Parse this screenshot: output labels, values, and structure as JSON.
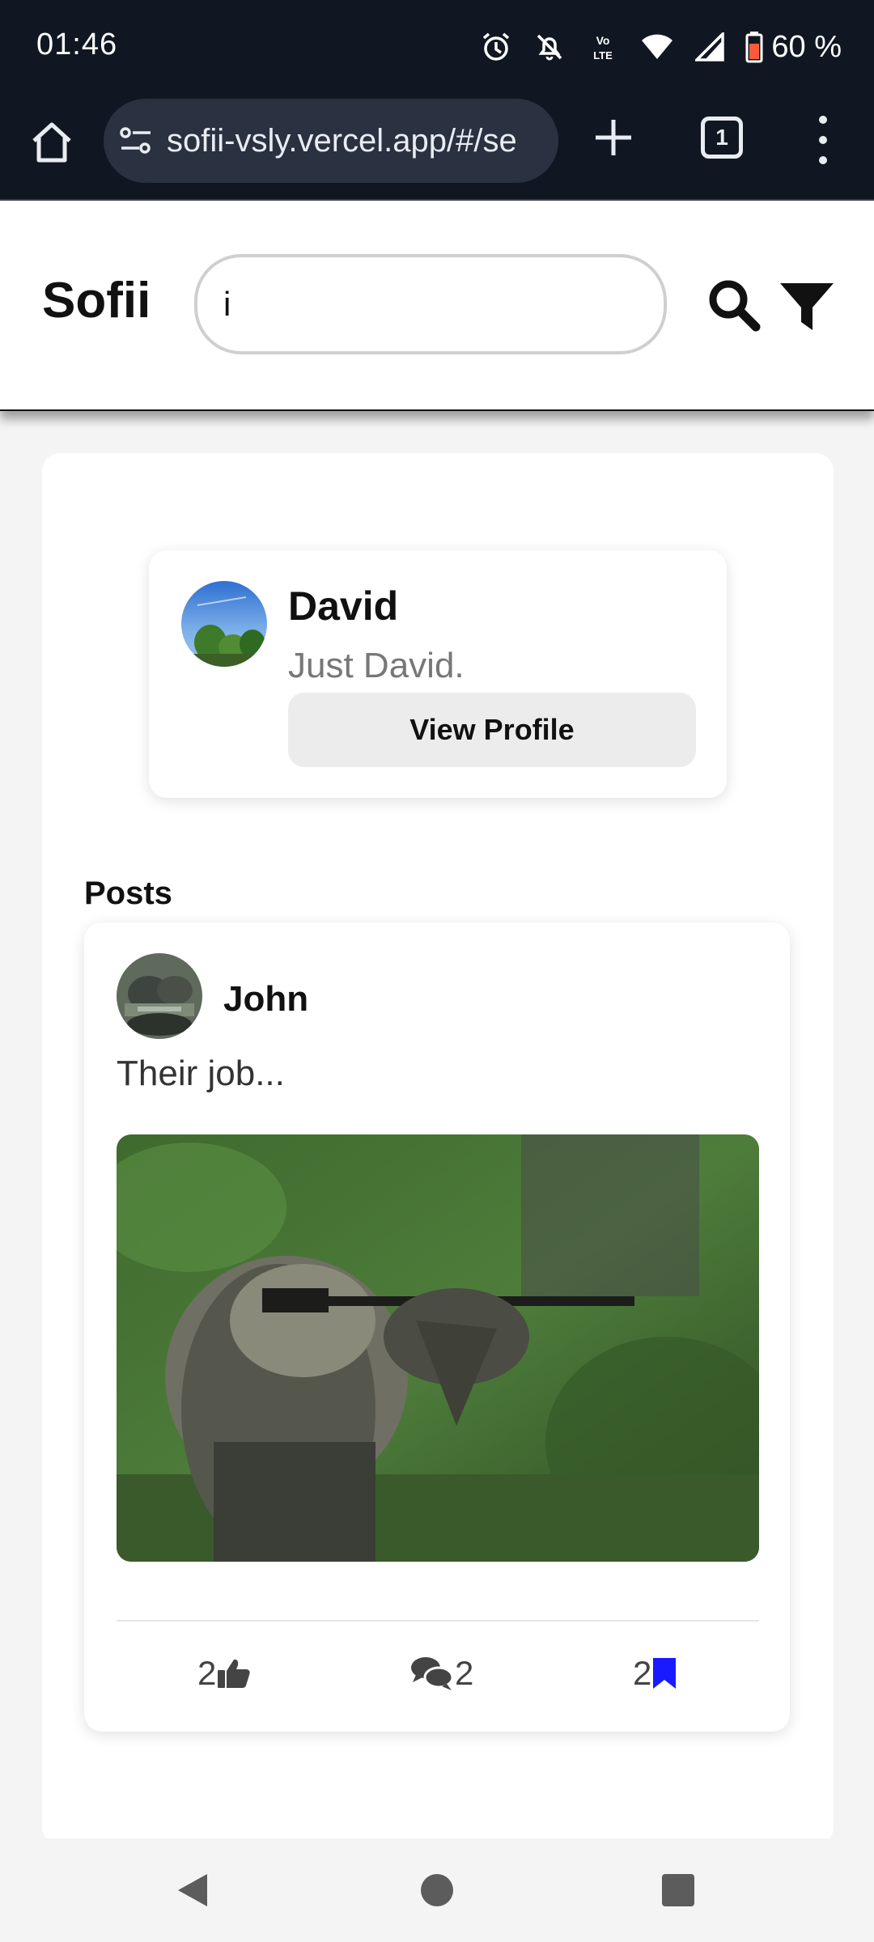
{
  "status_bar": {
    "time": "01:46",
    "battery": "60 %",
    "icons": [
      "alarm-icon",
      "silent-icon",
      "volte-icon",
      "wifi-icon",
      "signal-icon",
      "battery-icon"
    ]
  },
  "browser": {
    "url": "sofii-vsly.vercel.app/#/se",
    "tab_count": "1",
    "icons": [
      "home-icon",
      "site-settings-icon",
      "new-tab-icon",
      "tabs-icon",
      "more-menu-icon"
    ]
  },
  "header": {
    "logo": "Sofii",
    "search_value": "i",
    "icons": [
      "search-icon",
      "filter-icon"
    ]
  },
  "profile_result": {
    "name": "David",
    "bio": "Just David.",
    "button_label": "View Profile"
  },
  "posts": {
    "heading": "Posts",
    "items": [
      {
        "author": "John",
        "text": "Their job...",
        "likes": "2",
        "comments": "2",
        "saves": "2"
      }
    ]
  },
  "colors": {
    "status_bar_bg": "#111722",
    "bookmark_accent": "#1a1aff",
    "button_bg": "#ececec"
  }
}
